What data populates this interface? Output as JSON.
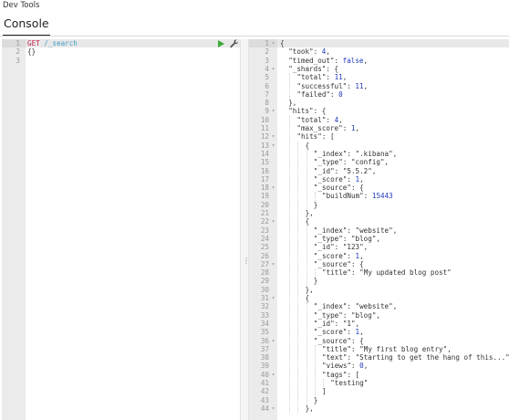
{
  "app": {
    "title": "Dev Tools"
  },
  "tabs": [
    {
      "label": "Console"
    }
  ],
  "request": {
    "lines": [
      {
        "n": "1",
        "parts": [
          {
            "t": "method",
            "v": "GET"
          },
          {
            "t": "space",
            "v": " "
          },
          {
            "t": "path",
            "v": "/_search"
          }
        ]
      },
      {
        "n": "2",
        "parts": [
          {
            "t": "bracket",
            "v": "{}"
          }
        ]
      },
      {
        "n": "3",
        "parts": []
      }
    ],
    "run_icon": "play-icon",
    "settings_icon": "wrench-icon"
  },
  "divider": {
    "handle": "⋮"
  },
  "response": {
    "lines": [
      {
        "n": "1",
        "fold": true,
        "ind": 0,
        "parts": [
          {
            "t": "punc",
            "v": "{"
          }
        ]
      },
      {
        "n": "2",
        "fold": false,
        "ind": 1,
        "parts": [
          {
            "t": "key",
            "v": "\"took\""
          },
          {
            "t": "punc",
            "v": ": "
          },
          {
            "t": "num",
            "v": "4"
          },
          {
            "t": "punc",
            "v": ","
          }
        ]
      },
      {
        "n": "3",
        "fold": false,
        "ind": 1,
        "parts": [
          {
            "t": "key",
            "v": "\"timed_out\""
          },
          {
            "t": "punc",
            "v": ": "
          },
          {
            "t": "bool",
            "v": "false"
          },
          {
            "t": "punc",
            "v": ","
          }
        ]
      },
      {
        "n": "4",
        "fold": true,
        "ind": 1,
        "parts": [
          {
            "t": "key",
            "v": "\"_shards\""
          },
          {
            "t": "punc",
            "v": ": {"
          }
        ]
      },
      {
        "n": "5",
        "fold": false,
        "ind": 2,
        "parts": [
          {
            "t": "key",
            "v": "\"total\""
          },
          {
            "t": "punc",
            "v": ": "
          },
          {
            "t": "num",
            "v": "11"
          },
          {
            "t": "punc",
            "v": ","
          }
        ]
      },
      {
        "n": "6",
        "fold": false,
        "ind": 2,
        "parts": [
          {
            "t": "key",
            "v": "\"successful\""
          },
          {
            "t": "punc",
            "v": ": "
          },
          {
            "t": "num",
            "v": "11"
          },
          {
            "t": "punc",
            "v": ","
          }
        ]
      },
      {
        "n": "7",
        "fold": false,
        "ind": 2,
        "parts": [
          {
            "t": "key",
            "v": "\"failed\""
          },
          {
            "t": "punc",
            "v": ": "
          },
          {
            "t": "num",
            "v": "0"
          }
        ]
      },
      {
        "n": "8",
        "fold": false,
        "ind": 1,
        "parts": [
          {
            "t": "punc",
            "v": "},"
          }
        ]
      },
      {
        "n": "9",
        "fold": true,
        "ind": 1,
        "parts": [
          {
            "t": "key",
            "v": "\"hits\""
          },
          {
            "t": "punc",
            "v": ": {"
          }
        ]
      },
      {
        "n": "10",
        "fold": false,
        "ind": 2,
        "parts": [
          {
            "t": "key",
            "v": "\"total\""
          },
          {
            "t": "punc",
            "v": ": "
          },
          {
            "t": "num",
            "v": "4"
          },
          {
            "t": "punc",
            "v": ","
          }
        ]
      },
      {
        "n": "11",
        "fold": false,
        "ind": 2,
        "parts": [
          {
            "t": "key",
            "v": "\"max_score\""
          },
          {
            "t": "punc",
            "v": ": "
          },
          {
            "t": "num",
            "v": "1"
          },
          {
            "t": "punc",
            "v": ","
          }
        ]
      },
      {
        "n": "12",
        "fold": true,
        "ind": 2,
        "parts": [
          {
            "t": "key",
            "v": "\"hits\""
          },
          {
            "t": "punc",
            "v": ": ["
          }
        ]
      },
      {
        "n": "13",
        "fold": true,
        "ind": 3,
        "parts": [
          {
            "t": "punc",
            "v": "{"
          }
        ]
      },
      {
        "n": "14",
        "fold": false,
        "ind": 4,
        "parts": [
          {
            "t": "key",
            "v": "\"_index\""
          },
          {
            "t": "punc",
            "v": ": "
          },
          {
            "t": "str",
            "v": "\".kibana\""
          },
          {
            "t": "punc",
            "v": ","
          }
        ]
      },
      {
        "n": "15",
        "fold": false,
        "ind": 4,
        "parts": [
          {
            "t": "key",
            "v": "\"_type\""
          },
          {
            "t": "punc",
            "v": ": "
          },
          {
            "t": "str",
            "v": "\"config\""
          },
          {
            "t": "punc",
            "v": ","
          }
        ]
      },
      {
        "n": "16",
        "fold": false,
        "ind": 4,
        "parts": [
          {
            "t": "key",
            "v": "\"_id\""
          },
          {
            "t": "punc",
            "v": ": "
          },
          {
            "t": "str",
            "v": "\"5.5.2\""
          },
          {
            "t": "punc",
            "v": ","
          }
        ]
      },
      {
        "n": "17",
        "fold": false,
        "ind": 4,
        "parts": [
          {
            "t": "key",
            "v": "\"_score\""
          },
          {
            "t": "punc",
            "v": ": "
          },
          {
            "t": "num",
            "v": "1"
          },
          {
            "t": "punc",
            "v": ","
          }
        ]
      },
      {
        "n": "18",
        "fold": true,
        "ind": 4,
        "parts": [
          {
            "t": "key",
            "v": "\"_source\""
          },
          {
            "t": "punc",
            "v": ": {"
          }
        ]
      },
      {
        "n": "19",
        "fold": false,
        "ind": 5,
        "parts": [
          {
            "t": "key",
            "v": "\"buildNum\""
          },
          {
            "t": "punc",
            "v": ": "
          },
          {
            "t": "num",
            "v": "15443"
          }
        ]
      },
      {
        "n": "20",
        "fold": false,
        "ind": 4,
        "parts": [
          {
            "t": "punc",
            "v": "}"
          }
        ]
      },
      {
        "n": "21",
        "fold": false,
        "ind": 3,
        "parts": [
          {
            "t": "punc",
            "v": "},"
          }
        ]
      },
      {
        "n": "22",
        "fold": true,
        "ind": 3,
        "parts": [
          {
            "t": "punc",
            "v": "{"
          }
        ]
      },
      {
        "n": "23",
        "fold": false,
        "ind": 4,
        "parts": [
          {
            "t": "key",
            "v": "\"_index\""
          },
          {
            "t": "punc",
            "v": ": "
          },
          {
            "t": "str",
            "v": "\"website\""
          },
          {
            "t": "punc",
            "v": ","
          }
        ]
      },
      {
        "n": "24",
        "fold": false,
        "ind": 4,
        "parts": [
          {
            "t": "key",
            "v": "\"_type\""
          },
          {
            "t": "punc",
            "v": ": "
          },
          {
            "t": "str",
            "v": "\"blog\""
          },
          {
            "t": "punc",
            "v": ","
          }
        ]
      },
      {
        "n": "25",
        "fold": false,
        "ind": 4,
        "parts": [
          {
            "t": "key",
            "v": "\"_id\""
          },
          {
            "t": "punc",
            "v": ": "
          },
          {
            "t": "str",
            "v": "\"123\""
          },
          {
            "t": "punc",
            "v": ","
          }
        ]
      },
      {
        "n": "26",
        "fold": false,
        "ind": 4,
        "parts": [
          {
            "t": "key",
            "v": "\"_score\""
          },
          {
            "t": "punc",
            "v": ": "
          },
          {
            "t": "num",
            "v": "1"
          },
          {
            "t": "punc",
            "v": ","
          }
        ]
      },
      {
        "n": "27",
        "fold": true,
        "ind": 4,
        "parts": [
          {
            "t": "key",
            "v": "\"_source\""
          },
          {
            "t": "punc",
            "v": ": {"
          }
        ]
      },
      {
        "n": "28",
        "fold": false,
        "ind": 5,
        "parts": [
          {
            "t": "key",
            "v": "\"title\""
          },
          {
            "t": "punc",
            "v": ": "
          },
          {
            "t": "str",
            "v": "\"My updated blog post\""
          }
        ]
      },
      {
        "n": "29",
        "fold": false,
        "ind": 4,
        "parts": [
          {
            "t": "punc",
            "v": "}"
          }
        ]
      },
      {
        "n": "30",
        "fold": false,
        "ind": 3,
        "parts": [
          {
            "t": "punc",
            "v": "},"
          }
        ]
      },
      {
        "n": "31",
        "fold": true,
        "ind": 3,
        "parts": [
          {
            "t": "punc",
            "v": "{"
          }
        ]
      },
      {
        "n": "32",
        "fold": false,
        "ind": 4,
        "parts": [
          {
            "t": "key",
            "v": "\"_index\""
          },
          {
            "t": "punc",
            "v": ": "
          },
          {
            "t": "str",
            "v": "\"website\""
          },
          {
            "t": "punc",
            "v": ","
          }
        ]
      },
      {
        "n": "33",
        "fold": false,
        "ind": 4,
        "parts": [
          {
            "t": "key",
            "v": "\"_type\""
          },
          {
            "t": "punc",
            "v": ": "
          },
          {
            "t": "str",
            "v": "\"blog\""
          },
          {
            "t": "punc",
            "v": ","
          }
        ]
      },
      {
        "n": "34",
        "fold": false,
        "ind": 4,
        "parts": [
          {
            "t": "key",
            "v": "\"_id\""
          },
          {
            "t": "punc",
            "v": ": "
          },
          {
            "t": "str",
            "v": "\"1\""
          },
          {
            "t": "punc",
            "v": ","
          }
        ]
      },
      {
        "n": "35",
        "fold": false,
        "ind": 4,
        "parts": [
          {
            "t": "key",
            "v": "\"_score\""
          },
          {
            "t": "punc",
            "v": ": "
          },
          {
            "t": "num",
            "v": "1"
          },
          {
            "t": "punc",
            "v": ","
          }
        ]
      },
      {
        "n": "36",
        "fold": true,
        "ind": 4,
        "parts": [
          {
            "t": "key",
            "v": "\"_source\""
          },
          {
            "t": "punc",
            "v": ": {"
          }
        ]
      },
      {
        "n": "37",
        "fold": false,
        "ind": 5,
        "parts": [
          {
            "t": "key",
            "v": "\"title\""
          },
          {
            "t": "punc",
            "v": ": "
          },
          {
            "t": "str",
            "v": "\"My first blog entry\""
          },
          {
            "t": "punc",
            "v": ","
          }
        ]
      },
      {
        "n": "38",
        "fold": false,
        "ind": 5,
        "parts": [
          {
            "t": "key",
            "v": "\"text\""
          },
          {
            "t": "punc",
            "v": ": "
          },
          {
            "t": "str",
            "v": "\"Starting to get the hang of this...\""
          },
          {
            "t": "punc",
            "v": ","
          }
        ]
      },
      {
        "n": "39",
        "fold": false,
        "ind": 5,
        "parts": [
          {
            "t": "key",
            "v": "\"views\""
          },
          {
            "t": "punc",
            "v": ": "
          },
          {
            "t": "num",
            "v": "0"
          },
          {
            "t": "punc",
            "v": ","
          }
        ]
      },
      {
        "n": "40",
        "fold": true,
        "ind": 5,
        "parts": [
          {
            "t": "key",
            "v": "\"tags\""
          },
          {
            "t": "punc",
            "v": ": ["
          }
        ]
      },
      {
        "n": "41",
        "fold": false,
        "ind": 6,
        "parts": [
          {
            "t": "str",
            "v": "\"testing\""
          }
        ]
      },
      {
        "n": "42",
        "fold": false,
        "ind": 5,
        "parts": [
          {
            "t": "punc",
            "v": "]"
          }
        ]
      },
      {
        "n": "43",
        "fold": false,
        "ind": 4,
        "parts": [
          {
            "t": "punc",
            "v": "}"
          }
        ]
      },
      {
        "n": "44",
        "fold": true,
        "ind": 3,
        "parts": [
          {
            "t": "punc",
            "v": "},"
          }
        ]
      }
    ]
  },
  "colors": {
    "method": "#c7254e",
    "path": "#3e9fc5",
    "number": "#1f37b8",
    "run": "#3cab3c",
    "gutter": "#ebebeb"
  }
}
